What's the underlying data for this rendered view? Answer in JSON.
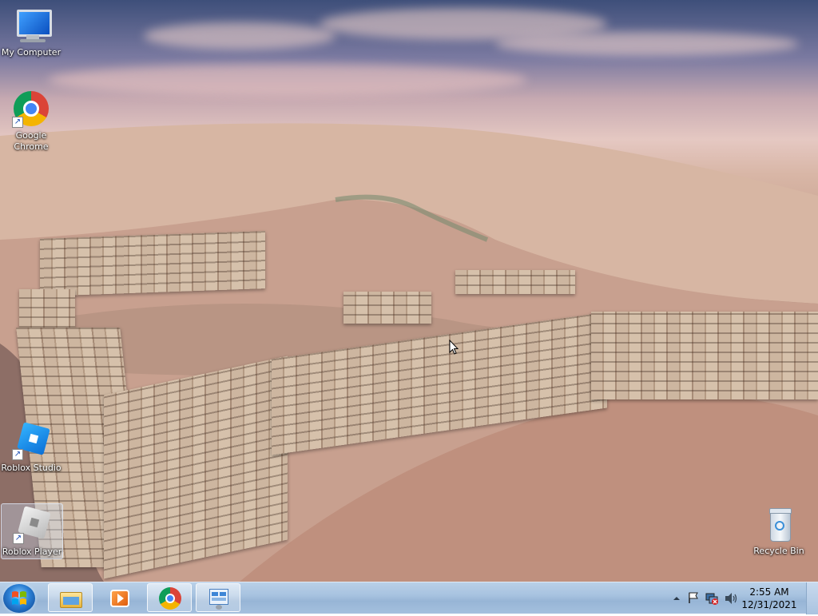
{
  "desktop": {
    "icons": [
      {
        "label": "My Computer",
        "icon": "computer-icon"
      },
      {
        "label": "Google Chrome",
        "icon": "chrome-icon",
        "label_line1": "Google",
        "label_line2": "Chrome"
      },
      {
        "label": "Roblox Studio",
        "icon": "roblox-studio-icon"
      },
      {
        "label": "Roblox Player",
        "icon": "roblox-player-icon"
      },
      {
        "label": "Recycle Bin",
        "icon": "recycle-bin-icon"
      }
    ]
  },
  "taskbar": {
    "start": {
      "icon": "windows-start-icon"
    },
    "pinned": [
      {
        "icon": "file-explorer-icon"
      },
      {
        "icon": "media-player-icon"
      },
      {
        "icon": "chrome-icon"
      },
      {
        "icon": "control-panel-icon"
      }
    ],
    "tray": {
      "icons": [
        "up-arrow-icon",
        "flag-icon",
        "network-icon",
        "volume-icon"
      ],
      "time": "2:55 AM",
      "date": "12/31/2021"
    }
  },
  "colors": {
    "taskbar": "#a8c3e0",
    "sky_top": "#3e4f7a",
    "sand": "#c8a290"
  }
}
